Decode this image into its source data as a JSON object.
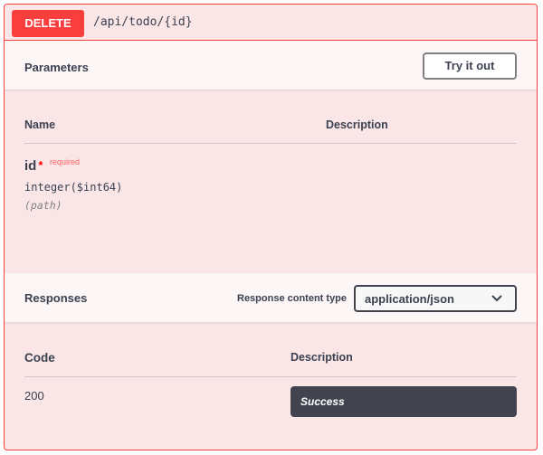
{
  "operation": {
    "method": "DELETE",
    "path": "/api/todo/{id}"
  },
  "parameters": {
    "title": "Parameters",
    "try_button": "Try it out",
    "columns": {
      "name": "Name",
      "description": "Description"
    },
    "items": [
      {
        "name": "id",
        "required_star": "*",
        "required_label": "required",
        "type": "integer($int64)",
        "in": "(path)"
      }
    ]
  },
  "responses": {
    "title": "Responses",
    "content_type_label": "Response content type",
    "content_type_value": "application/json",
    "columns": {
      "code": "Code",
      "description": "Description"
    },
    "items": [
      {
        "code": "200",
        "description": "Success"
      }
    ]
  },
  "colors": {
    "delete": "#f93e3e",
    "block_bg": "#fae6e6",
    "section_bg": "#fcf6f6",
    "dark": "#41444e",
    "text": "#3b4151"
  },
  "icons": {
    "select_chevron": "chevron-down-icon"
  }
}
